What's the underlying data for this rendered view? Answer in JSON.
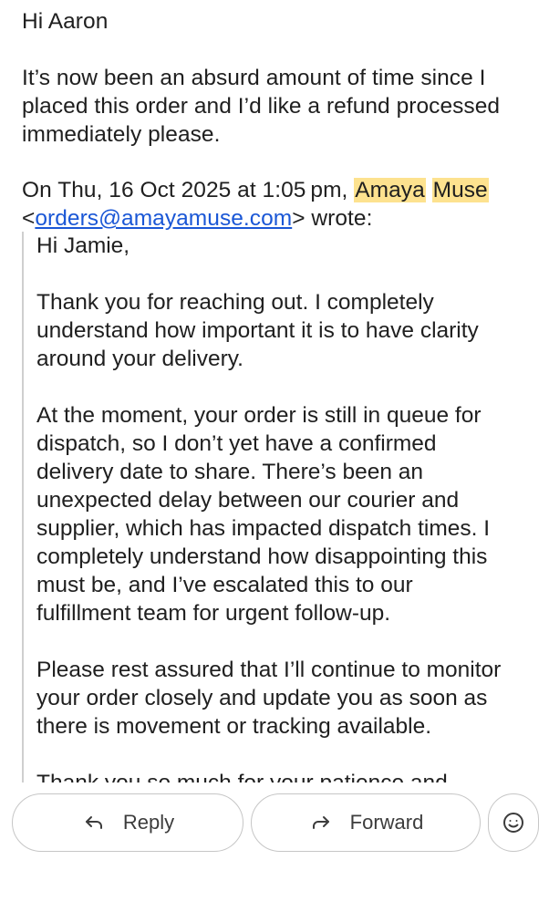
{
  "email": {
    "greeting": "Hi Aaron",
    "message": "It’s now been an absurd amount of time since I\nplaced this order and I’d like a refund processed\nimmediately please.",
    "attribution": {
      "prefix": "On Thu, 16 Oct 2025 at 1:05 pm,",
      "sender_first": "Amaya",
      "sender_last": "Muse",
      "open_bracket": "<",
      "email": "orders@amayamuse.com",
      "suffix": "> wrote:"
    },
    "quoted": {
      "greeting": "Hi Jamie,",
      "para1": "Thank you for reaching out. I completely\nunderstand how important it is to have clarity\naround your delivery.",
      "para2": "At the moment, your order is still in queue for\ndispatch, so I don’t yet have a confirmed\ndelivery date to share. There’s been an\nunexpected delay between our courier and\nsupplier, which has impacted dispatch times. I\ncompletely understand how disappointing this\nmust be, and I’ve escalated this to our\nfulfillment team for urgent follow-up.",
      "para3": "Please rest assured that I’ll continue to monitor\nyour order closely and update you as soon as\nthere is movement or tracking available.",
      "para4": "Thank you so much for your patience and"
    }
  },
  "actions": {
    "reply_label": "Reply",
    "forward_label": "Forward",
    "reply_icon": "reply-arrow-icon",
    "forward_icon": "forward-arrow-icon",
    "emoji_icon": "smiley-face-icon"
  },
  "colors": {
    "highlight": "#fde28f",
    "link": "#1a57d6",
    "quote_bar": "#cfcfcf",
    "button_border": "#c6c6c6"
  }
}
